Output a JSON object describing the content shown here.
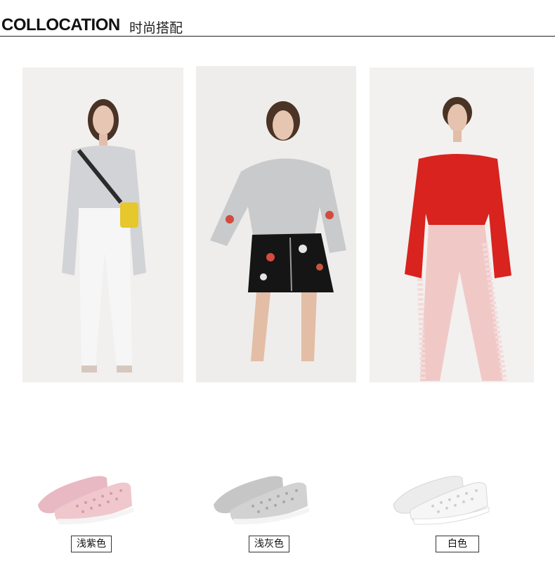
{
  "header": {
    "title_en": "COLLOCATION",
    "title_cn": "时尚搭配"
  },
  "looks": [
    {
      "photo_name": "look-photo-grey-sweater-white-pants"
    },
    {
      "photo_name": "look-photo-grey-hoodie-black-skirt"
    },
    {
      "photo_name": "look-photo-red-top-pink-pants"
    }
  ],
  "shoes": [
    {
      "color_label": "浅紫色",
      "swatch": "#e8b9c2"
    },
    {
      "color_label": "浅灰色",
      "swatch": "#c9c9c9"
    },
    {
      "color_label": "白色",
      "swatch": "#f4f4f4"
    }
  ]
}
